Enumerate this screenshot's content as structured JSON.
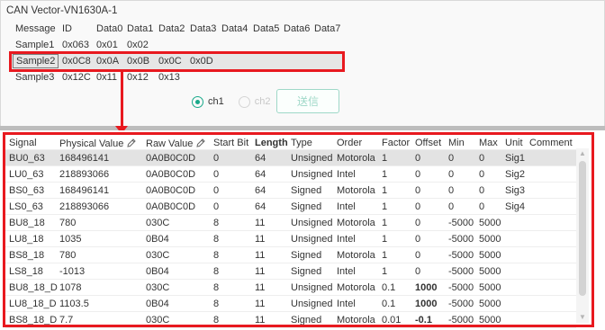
{
  "window_title": "CAN Vector-VN1630A-1",
  "message_table": {
    "headers": [
      "Message",
      "ID",
      "Data0",
      "Data1",
      "Data2",
      "Data3",
      "Data4",
      "Data5",
      "Data6",
      "Data7"
    ],
    "rows": [
      {
        "message": "Sample1",
        "id": "0x063",
        "data": [
          "0x01",
          "0x02",
          "",
          "",
          "",
          "",
          "",
          ""
        ]
      },
      {
        "message": "Sample2",
        "id": "0x0C8",
        "data": [
          "0x0A",
          "0x0B",
          "0x0C",
          "0x0D",
          "",
          "",
          "",
          ""
        ]
      },
      {
        "message": "Sample3",
        "id": "0x12C",
        "data": [
          "0x11",
          "0x12",
          "0x13",
          "",
          "",
          "",
          "",
          ""
        ]
      }
    ],
    "selected_message": "Sample2"
  },
  "channels": {
    "ch1": {
      "label": "ch1",
      "checked": true,
      "enabled": true
    },
    "ch2": {
      "label": "ch2",
      "checked": false,
      "enabled": false
    }
  },
  "send_button": {
    "label": "送信",
    "enabled": false
  },
  "signal_table": {
    "headers": [
      "Signal",
      "Physical Value",
      "Raw Value",
      "Start Bit",
      "Length",
      "Type",
      "Order",
      "Factor",
      "Offset",
      "Min",
      "Max",
      "Unit",
      "Comment"
    ],
    "editable_columns": [
      "Physical Value",
      "Raw Value"
    ],
    "rows": [
      {
        "signal": "BU0_63",
        "physical": "168496141",
        "raw": "0A0B0C0D",
        "start_bit": "0",
        "length": "64",
        "type": "Unsigned",
        "order": "Motorola",
        "factor": "1",
        "offset": "0",
        "min": "0",
        "max": "0",
        "unit": "Sig1",
        "comment": ""
      },
      {
        "signal": "LU0_63",
        "physical": "218893066",
        "raw": "0A0B0C0D",
        "start_bit": "0",
        "length": "64",
        "type": "Unsigned",
        "order": "Intel",
        "factor": "1",
        "offset": "0",
        "min": "0",
        "max": "0",
        "unit": "Sig2",
        "comment": ""
      },
      {
        "signal": "BS0_63",
        "physical": "168496141",
        "raw": "0A0B0C0D",
        "start_bit": "0",
        "length": "64",
        "type": "Signed",
        "order": "Motorola",
        "factor": "1",
        "offset": "0",
        "min": "0",
        "max": "0",
        "unit": "Sig3",
        "comment": ""
      },
      {
        "signal": "LS0_63",
        "physical": "218893066",
        "raw": "0A0B0C0D",
        "start_bit": "0",
        "length": "64",
        "type": "Signed",
        "order": "Intel",
        "factor": "1",
        "offset": "0",
        "min": "0",
        "max": "0",
        "unit": "Sig4",
        "comment": ""
      },
      {
        "signal": "BU8_18",
        "physical": "780",
        "raw": "030C",
        "start_bit": "8",
        "length": "11",
        "type": "Unsigned",
        "order": "Motorola",
        "factor": "1",
        "offset": "0",
        "min": "-5000",
        "max": "5000",
        "unit": "",
        "comment": ""
      },
      {
        "signal": "LU8_18",
        "physical": "1035",
        "raw": "0B04",
        "start_bit": "8",
        "length": "11",
        "type": "Unsigned",
        "order": "Intel",
        "factor": "1",
        "offset": "0",
        "min": "-5000",
        "max": "5000",
        "unit": "",
        "comment": ""
      },
      {
        "signal": "BS8_18",
        "physical": "780",
        "raw": "030C",
        "start_bit": "8",
        "length": "11",
        "type": "Signed",
        "order": "Motorola",
        "factor": "1",
        "offset": "0",
        "min": "-5000",
        "max": "5000",
        "unit": "",
        "comment": ""
      },
      {
        "signal": "LS8_18",
        "physical": "-1013",
        "raw": "0B04",
        "start_bit": "8",
        "length": "11",
        "type": "Signed",
        "order": "Intel",
        "factor": "1",
        "offset": "0",
        "min": "-5000",
        "max": "5000",
        "unit": "",
        "comment": ""
      },
      {
        "signal": "BU8_18_D",
        "physical": "1078",
        "raw": "030C",
        "start_bit": "8",
        "length": "11",
        "type": "Unsigned",
        "order": "Motorola",
        "factor": "0.1",
        "offset": "1000",
        "min": "-5000",
        "max": "5000",
        "unit": "",
        "comment": ""
      },
      {
        "signal": "LU8_18_D",
        "physical": "1103.5",
        "raw": "0B04",
        "start_bit": "8",
        "length": "11",
        "type": "Unsigned",
        "order": "Intel",
        "factor": "0.1",
        "offset": "1000",
        "min": "-5000",
        "max": "5000",
        "unit": "",
        "comment": ""
      },
      {
        "signal": "BS8_18_D",
        "physical": "7.7",
        "raw": "030C",
        "start_bit": "8",
        "length": "11",
        "type": "Signed",
        "order": "Motorola",
        "factor": "0.01",
        "offset": "-0.1",
        "min": "-5000",
        "max": "5000",
        "unit": "",
        "comment": ""
      }
    ],
    "selected_row": "BU0_63",
    "bold_offsets_in_rows": [
      "BU8_18_D",
      "LU8_18_D",
      "BS8_18_D"
    ]
  },
  "colors": {
    "highlight": "#e8191f",
    "accent": "#19a98a",
    "selected_row": "#e3e3e3"
  },
  "icons": {
    "edit": "pencil-icon",
    "scroll_up": "scroll-up-arrow-icon",
    "scroll_down": "scroll-down-arrow-icon"
  }
}
